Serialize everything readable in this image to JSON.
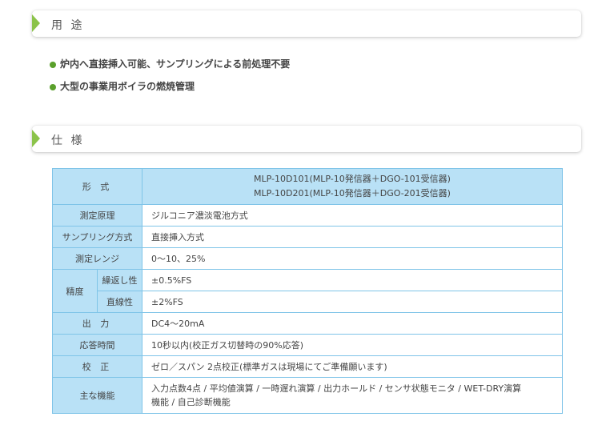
{
  "usage": {
    "heading": "用 途",
    "items": [
      "炉内へ直接挿入可能、サンプリングによる前処理不要",
      "大型の事業用ボイラの燃焼管理"
    ]
  },
  "spec": {
    "heading": "仕 様",
    "model_label": "形 式",
    "model_line1": "MLP-10D101(MLP-10発信器＋DGO-101受信器)",
    "model_line2": "MLP-10D201(MLP-10発信器＋DGO-201受信器)",
    "rows": [
      {
        "label": "測定原理",
        "value": "ジルコニア濃淡電池方式"
      },
      {
        "label": "サンプリング方式",
        "value": "直接挿入方式"
      },
      {
        "label": "測定レンジ",
        "value": "0～10、25%"
      }
    ],
    "accuracy": {
      "label": "精度",
      "sub": [
        {
          "label": "繰返し性",
          "value": "±0.5%FS"
        },
        {
          "label": "直線性",
          "value": "±2%FS"
        }
      ]
    },
    "rows2": [
      {
        "label": "出 力",
        "value": "DC4～20mA"
      },
      {
        "label": "応答時間",
        "value": "10秒以内(校正ガス切替時の90%応答)"
      },
      {
        "label": "校 正",
        "value": "ゼロ／スパン 2点校正(標準ガスは現場にてご準備願います)"
      }
    ],
    "features": {
      "label": "主な機能",
      "line1": "入力点数4点 / 平均値演算 / 一時遅れ演算 / 出力ホールド / センサ状態モニタ / WET-DRY演算",
      "line2": "機能 / 自己診断機能"
    }
  }
}
